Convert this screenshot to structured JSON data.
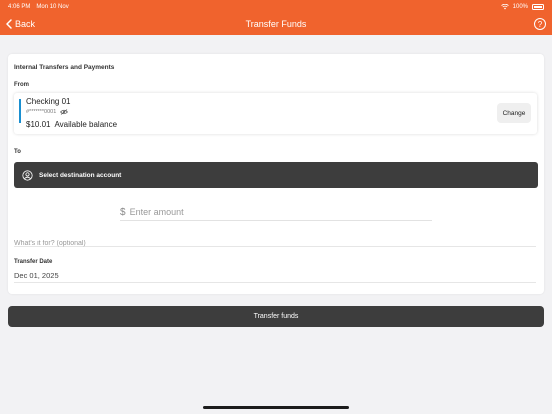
{
  "status_bar": {
    "time": "4:06 PM",
    "date": "Mon 10 Nov",
    "battery": "100%"
  },
  "nav": {
    "back_label": "Back",
    "title": "Transfer Funds",
    "help_glyph": "?"
  },
  "form": {
    "section_title": "Internal Transfers and Payments",
    "from_label": "From",
    "from_account": {
      "name": "Checking 01",
      "number": "#*******0001",
      "balance": "$10.01",
      "balance_label": "Available balance",
      "change_label": "Change"
    },
    "to_label": "To",
    "destination_label": "Select destination account",
    "amount": {
      "currency_symbol": "$",
      "placeholder": "Enter amount",
      "value": ""
    },
    "memo": {
      "placeholder": "What's it for? (optional)",
      "value": ""
    },
    "date_label": "Transfer Date",
    "date_value": "Dec 01, 2025"
  },
  "submit_label": "Transfer funds",
  "colors": {
    "brand": "#f0632d",
    "accent": "#1a8fd0",
    "dark_button": "#3d3d3d"
  },
  "icons": {
    "back": "chevron-left-icon",
    "help": "question-circle-icon",
    "hide": "eye-slash-icon",
    "account": "user-circle-icon",
    "wifi": "wifi-icon",
    "battery": "battery-icon"
  }
}
